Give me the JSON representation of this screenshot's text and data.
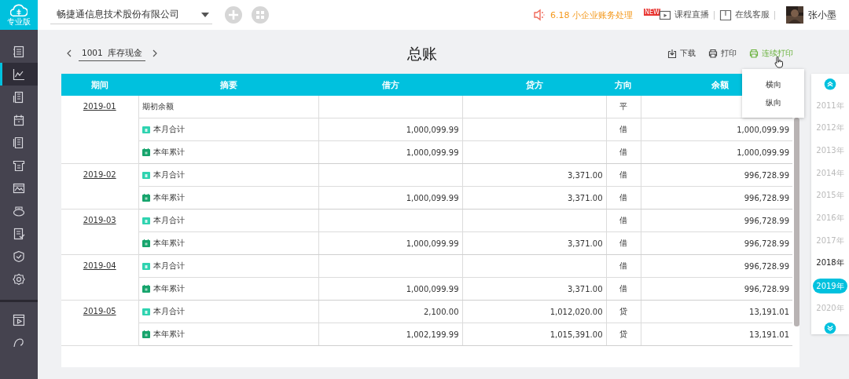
{
  "sidebar": {
    "logo": {
      "label": "专业版"
    },
    "items": [
      {
        "selected": false
      },
      {
        "selected": true
      },
      {
        "selected": false
      },
      {
        "selected": false
      },
      {
        "selected": false
      },
      {
        "selected": false
      },
      {
        "selected": false
      },
      {
        "selected": false
      },
      {
        "selected": false
      },
      {
        "selected": false
      },
      {
        "selected": false
      }
    ],
    "bottom_items": [
      {
        "selected": false
      },
      {
        "selected": false
      }
    ]
  },
  "header": {
    "company": {
      "value": "畅捷通信息技术股份有限公司"
    },
    "promo": "6.18 小企业账务处理",
    "links": [
      {
        "label": "课程直播",
        "badge": "NEW",
        "kind": "video"
      },
      {
        "label": "在线客服",
        "kind": "book"
      }
    ],
    "user": {
      "name": "张小墨"
    }
  },
  "toolbar": {
    "account": {
      "code": "1001",
      "name": "库存现金"
    },
    "title": "总账",
    "actions": [
      {
        "label": "下载",
        "kind": "download",
        "hovered": false
      },
      {
        "label": "打印",
        "kind": "print",
        "hovered": false
      },
      {
        "label": "连续打印",
        "kind": "continuous_print",
        "hovered": true
      }
    ]
  },
  "print_menu": {
    "items": [
      "横向",
      "纵向"
    ]
  },
  "table": {
    "columns": [
      "期间",
      "摘要",
      "借方",
      "贷方",
      "方向",
      "余额"
    ],
    "groups": [
      {
        "period": "2019-01",
        "rows": [
          {
            "kind": "opening",
            "summary": "期初余额",
            "direction": "平"
          },
          {
            "kind": "month",
            "summary": "本月合计",
            "debit": "1,000,099.99",
            "direction": "借",
            "balance": "1,000,099.99"
          },
          {
            "kind": "year",
            "summary": "本年累计",
            "debit": "1,000,099.99",
            "direction": "借",
            "balance": "1,000,099.99"
          }
        ]
      },
      {
        "period": "2019-02",
        "rows": [
          {
            "kind": "month",
            "summary": "本月合计",
            "credit": "3,371.00",
            "direction": "借",
            "balance": "996,728.99"
          },
          {
            "kind": "year",
            "summary": "本年累计",
            "debit": "1,000,099.99",
            "credit": "3,371.00",
            "direction": "借",
            "balance": "996,728.99"
          }
        ]
      },
      {
        "period": "2019-03",
        "rows": [
          {
            "kind": "month",
            "summary": "本月合计",
            "direction": "借",
            "balance": "996,728.99"
          },
          {
            "kind": "year",
            "summary": "本年累计",
            "debit": "1,000,099.99",
            "credit": "3,371.00",
            "direction": "借",
            "balance": "996,728.99"
          }
        ]
      },
      {
        "period": "2019-04",
        "rows": [
          {
            "kind": "month",
            "summary": "本月合计",
            "direction": "借",
            "balance": "996,728.99"
          },
          {
            "kind": "year",
            "summary": "本年累计",
            "debit": "1,000,099.99",
            "credit": "3,371.00",
            "direction": "借",
            "balance": "996,728.99"
          }
        ]
      },
      {
        "period": "2019-05",
        "rows": [
          {
            "kind": "month",
            "summary": "本月合计",
            "debit": "2,100.00",
            "credit": "1,012,020.00",
            "direction": "贷",
            "balance": "13,191.01"
          },
          {
            "kind": "year",
            "summary": "本年累计",
            "debit": "1,002,199.99",
            "credit": "1,015,391.00",
            "direction": "贷",
            "balance": "13,191.01"
          }
        ]
      }
    ]
  },
  "years": {
    "items": [
      {
        "label": "2011年",
        "disabled": true,
        "selected": false
      },
      {
        "label": "2012年",
        "disabled": true,
        "selected": false
      },
      {
        "label": "2013年",
        "disabled": true,
        "selected": false
      },
      {
        "label": "2014年",
        "disabled": true,
        "selected": false
      },
      {
        "label": "2015年",
        "disabled": true,
        "selected": false
      },
      {
        "label": "2016年",
        "disabled": true,
        "selected": false
      },
      {
        "label": "2017年",
        "disabled": true,
        "selected": false
      },
      {
        "label": "2018年",
        "disabled": false,
        "selected": false
      },
      {
        "label": "2019年",
        "disabled": false,
        "selected": true
      },
      {
        "label": "2020年",
        "disabled": true,
        "selected": false
      }
    ]
  }
}
